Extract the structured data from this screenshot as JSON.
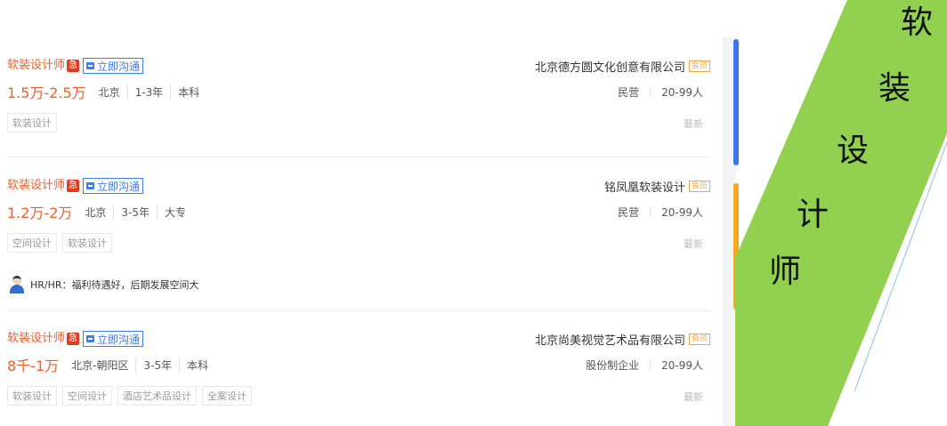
{
  "jobs": [
    {
      "title": "软装设计师",
      "urgent": "急",
      "chat": "立即沟通",
      "company": "北京德方圆文化创意有限公司",
      "vip": "会员",
      "salary": "1.5万-2.5万",
      "location": "北京",
      "experience": "1-3年",
      "education": "本科",
      "company_type": "民营",
      "company_size": "20-99人",
      "tags": [
        "软装设计"
      ],
      "status": "最新"
    },
    {
      "title": "软装设计师",
      "urgent": "急",
      "chat": "立即沟通",
      "company": "铭凤凰软装设计",
      "vip": "会员",
      "salary": "1.2万-2万",
      "location": "北京",
      "experience": "3-5年",
      "education": "大专",
      "company_type": "民营",
      "company_size": "20-99人",
      "tags": [
        "空间设计",
        "软装设计"
      ],
      "status": "最新",
      "hr_comment": "HR/HR：福利待遇好，后期发展空间大"
    },
    {
      "title": "软装设计师",
      "urgent": "急",
      "chat": "立即沟通",
      "company": "北京尚美视觉艺术品有限公司",
      "vip": "会员",
      "salary": "8千-1万",
      "location": "北京-朝阳区",
      "experience": "3-5年",
      "education": "本科",
      "company_type": "股份制企业",
      "company_size": "20-99人",
      "tags": [
        "软装设计",
        "空间设计",
        "酒店艺术品设计",
        "全案设计"
      ],
      "status": "最新"
    }
  ],
  "banner": {
    "chars": [
      "软",
      "装",
      "设",
      "计",
      "师"
    ],
    "color": "#92d050"
  },
  "colors": {
    "accent": "#ee5f2c",
    "link": "#3d7cf6",
    "urgent": "#e8391c",
    "vip": "#f3a64b"
  }
}
